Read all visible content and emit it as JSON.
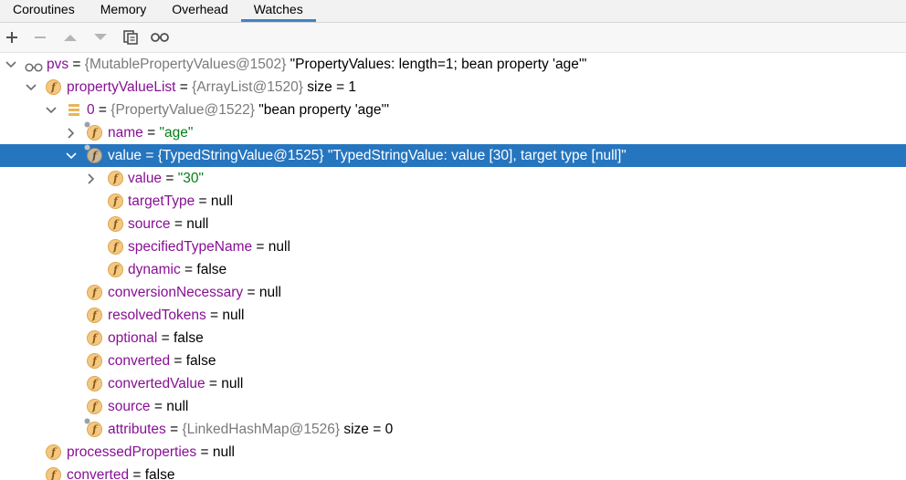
{
  "tabs": [
    "Coroutines",
    "Memory",
    "Overhead",
    "Watches"
  ],
  "active_tab": "Watches",
  "colors": {
    "selection": "#2675bf",
    "field_name": "#871094",
    "string_value": "#067d17",
    "type_label": "#7a7a7a",
    "field_icon": "#f4c882"
  },
  "toolbar": {
    "add_icon": "plus-icon",
    "remove_icon": "minus-icon",
    "up_icon": "arrow-up-icon",
    "down_icon": "arrow-down-icon",
    "copy_icon": "copy-icon",
    "watch_icon": "glasses-icon"
  },
  "tree": [
    {
      "name": "pvs",
      "eq": " = ",
      "type": "{MutablePropertyValues@1502}",
      "value": " \"PropertyValues: length=1; bean property 'age'\""
    },
    {
      "name": "propertyValueList",
      "eq": " = ",
      "type": "{ArrayList@1520}",
      "value": "  size = 1"
    },
    {
      "name": "0",
      "eq": " = ",
      "type": "{PropertyValue@1522}",
      "value": " \"bean property 'age'\""
    },
    {
      "name": "name",
      "eq": " = ",
      "type": "",
      "value": "\"age\""
    },
    {
      "name": "value",
      "eq": " = ",
      "type": "{TypedStringValue@1525}",
      "value": " \"TypedStringValue: value [30], target type [null]\""
    },
    {
      "name": "value",
      "eq": " = ",
      "type": "",
      "value": "\"30\""
    },
    {
      "name": "targetType",
      "eq": " = ",
      "type": "",
      "value": "null"
    },
    {
      "name": "source",
      "eq": " = ",
      "type": "",
      "value": "null"
    },
    {
      "name": "specifiedTypeName",
      "eq": " = ",
      "type": "",
      "value": "null"
    },
    {
      "name": "dynamic",
      "eq": " = ",
      "type": "",
      "value": "false"
    },
    {
      "name": "conversionNecessary",
      "eq": " = ",
      "type": "",
      "value": "null"
    },
    {
      "name": "resolvedTokens",
      "eq": " = ",
      "type": "",
      "value": "null"
    },
    {
      "name": "optional",
      "eq": " = ",
      "type": "",
      "value": "false"
    },
    {
      "name": "converted",
      "eq": " = ",
      "type": "",
      "value": "false"
    },
    {
      "name": "convertedValue",
      "eq": " = ",
      "type": "",
      "value": "null"
    },
    {
      "name": "source",
      "eq": " = ",
      "type": "",
      "value": "null"
    },
    {
      "name": "attributes",
      "eq": " = ",
      "type": "{LinkedHashMap@1526}",
      "value": "  size = 0"
    },
    {
      "name": "processedProperties",
      "eq": " = ",
      "type": "",
      "value": "null"
    },
    {
      "name": "converted",
      "eq": " = ",
      "type": "",
      "value": "false"
    }
  ]
}
